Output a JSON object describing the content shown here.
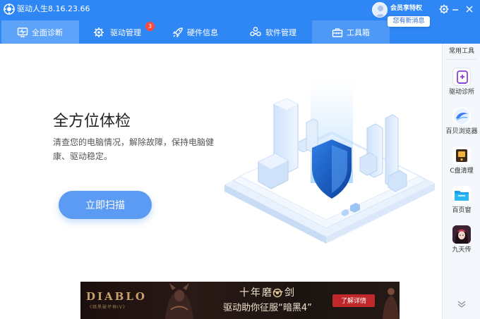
{
  "titlebar": {
    "title": "驱动人生8.16.23.66",
    "vip_label": "会员享特权",
    "new_message": "您有新消息",
    "icons": [
      "driver-logo-icon",
      "user-avatar-icon",
      "settings-icon",
      "minimize-icon",
      "close-icon"
    ]
  },
  "tabs": [
    {
      "label": "全面诊断",
      "icon": "monitor-pulse-icon",
      "active": true
    },
    {
      "label": "驱动管理",
      "icon": "gear-icon",
      "badge": "3"
    },
    {
      "label": "硬件信息",
      "icon": "rocket-icon"
    },
    {
      "label": "软件管理",
      "icon": "cubes-icon"
    },
    {
      "label": "工具箱",
      "icon": "toolbox-icon"
    }
  ],
  "main": {
    "title": "全方位体检",
    "description": "清查您的电脑情况，解除故障，保持电脑健康、驱动稳定。",
    "scan_button": "立即扫描"
  },
  "sidebar": {
    "title": "常用工具",
    "items": [
      {
        "label": "驱动诊所",
        "icon": "driver-clinic-icon"
      },
      {
        "label": "百贝浏览器",
        "icon": "browser-icon"
      },
      {
        "label": "C盘清理",
        "icon": "disk-clean-icon"
      },
      {
        "label": "百页窗",
        "icon": "window-folder-icon"
      },
      {
        "label": "九天传",
        "icon": "game-avatar-icon"
      }
    ],
    "more_icon": "double-chevron-down-icon"
  },
  "banner": {
    "logo": "DIABLO",
    "logo_sub": "《暗黑破坏神IV》",
    "line1": "十年磨一剑",
    "line2": "驱动助你征服“暗黑4”",
    "button": "了解详情"
  },
  "colors": {
    "brand_blue": "#2f86f5",
    "active_tab": "#5ea3fa",
    "scan_button": "#5b9bf3",
    "badge_red": "#ff4a3d"
  }
}
